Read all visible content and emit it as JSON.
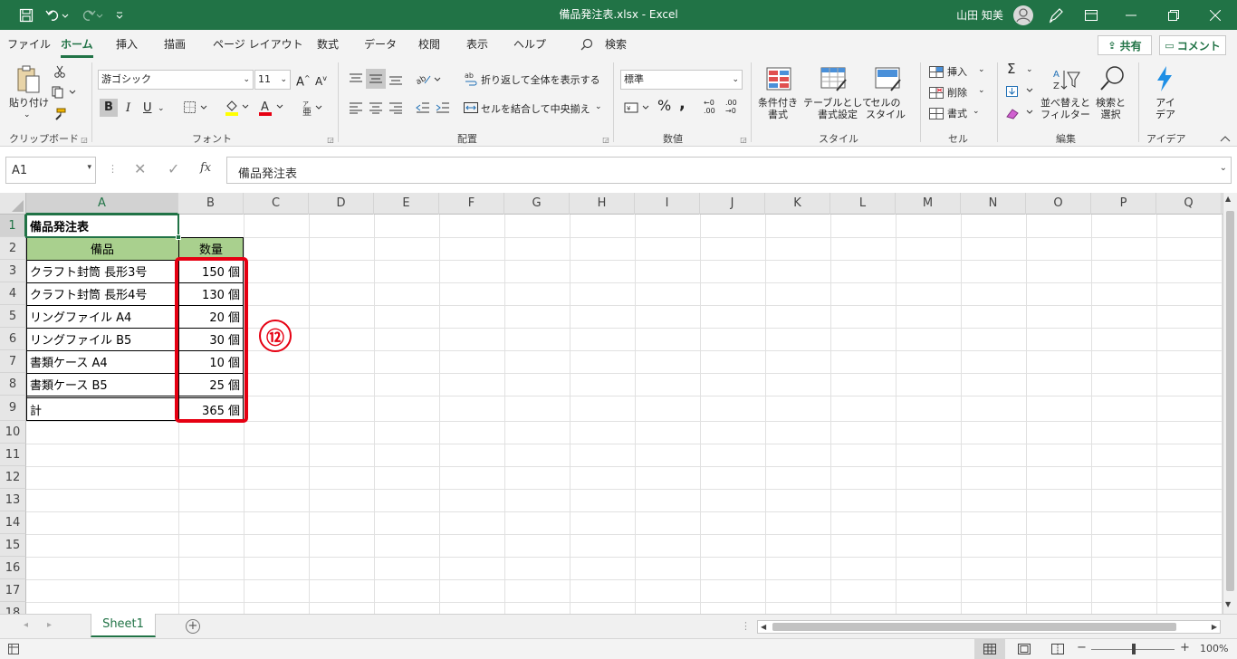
{
  "window": {
    "title": "備品発注表.xlsx  -  Excel",
    "user": "山田 知美"
  },
  "tabs": [
    "ファイル",
    "ホーム",
    "挿入",
    "描画",
    "ページ レイアウト",
    "数式",
    "データ",
    "校閲",
    "表示",
    "ヘルプ"
  ],
  "active_tab": "ホーム",
  "search_label": "検索",
  "share_label": "共有",
  "comment_label": "コメント",
  "ribbon": {
    "clipboard": {
      "paste": "貼り付け",
      "label": "クリップボード"
    },
    "font": {
      "name": "游ゴシック",
      "size": "11",
      "bold": "B",
      "italic": "I",
      "underline": "U",
      "label": "フォント"
    },
    "alignment": {
      "wrap": "折り返して全体を表示する",
      "merge": "セルを結合して中央揃え",
      "label": "配置"
    },
    "number": {
      "format": "標準",
      "label": "数値"
    },
    "styles": {
      "cond": "条件付き\n書式",
      "table": "テーブルとして\n書式設定",
      "cellstyle": "セルの\nスタイル",
      "label": "スタイル"
    },
    "cells": {
      "insert": "挿入",
      "delete": "削除",
      "format": "書式",
      "label": "セル"
    },
    "editing": {
      "sort": "並べ替えと\nフィルター",
      "find": "検索と\n選択",
      "label": "編集"
    },
    "ideas": {
      "button": "アイ\nデア",
      "label": "アイデア"
    }
  },
  "formula_bar": {
    "name_box": "A1",
    "fx": "fx",
    "content": "備品発注表"
  },
  "columns": [
    "A",
    "B",
    "C",
    "D",
    "E",
    "F",
    "G",
    "H",
    "I",
    "J",
    "K",
    "L",
    "M",
    "N",
    "O",
    "P",
    "Q"
  ],
  "rows": [
    "1",
    "2",
    "3",
    "4",
    "5",
    "6",
    "7",
    "8",
    "9",
    "10",
    "11",
    "12",
    "13",
    "14",
    "15",
    "16",
    "17",
    "18"
  ],
  "cells": {
    "title": "備品発注表",
    "header_item": "備品",
    "header_qty": "数量",
    "items": [
      {
        "name": "クラフト封筒 長形3号",
        "qty": "150 個"
      },
      {
        "name": "クラフト封筒 長形4号",
        "qty": "130 個"
      },
      {
        "name": "リングファイル A4",
        "qty": "20 個"
      },
      {
        "name": "リングファイル B5",
        "qty": "30 個"
      },
      {
        "name": "書類ケース A4",
        "qty": "10 個"
      },
      {
        "name": "書類ケース B5",
        "qty": "25 個"
      }
    ],
    "total_label": "計",
    "total_qty": "365 個"
  },
  "annotation": "⑫",
  "colors": {
    "header_fill": "#a9d08e",
    "highlight": "#e60012",
    "excel_green": "#217346"
  },
  "sheet_tab": "Sheet1",
  "zoom": "100%"
}
